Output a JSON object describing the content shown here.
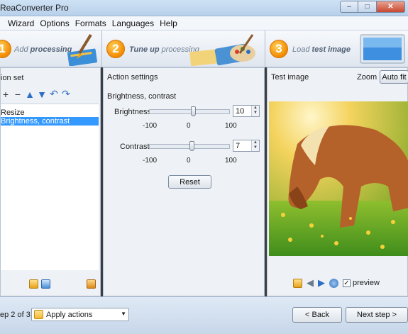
{
  "window": {
    "title": "ReaConverter Pro"
  },
  "menu": [
    "Wizard",
    "Options",
    "Formats",
    "Languages",
    "Help"
  ],
  "steps": [
    {
      "num": "1",
      "pre": "Add",
      "bold": "processing"
    },
    {
      "num": "2",
      "pre": "Tune up",
      "bold": "processing"
    },
    {
      "num": "3",
      "pre": "Load",
      "bold": "test image"
    }
  ],
  "left_panel": {
    "title": "ion set",
    "actions": [
      {
        "label": "Resize",
        "selected": false
      },
      {
        "label": "Brightness, contrast",
        "selected": true
      }
    ]
  },
  "middle_panel": {
    "title": "Action settings",
    "subtitle": "Brightness, contrast",
    "sliders": [
      {
        "label": "Brightness",
        "value": "10",
        "min": "-100",
        "mid": "0",
        "max": "100",
        "position": 0.55
      },
      {
        "label": "Contrast",
        "value": "7",
        "min": "-100",
        "mid": "0",
        "max": "100",
        "position": 0.535
      }
    ],
    "reset_label": "Reset"
  },
  "right_panel": {
    "title": "Test image",
    "zoom_label": "Zoom",
    "zoom_value": "Auto fit",
    "preview_label": "preview",
    "preview_checked": true
  },
  "bottom": {
    "step_text": "ep 2 of 3:",
    "apply_label": "Apply actions",
    "back_label": "< Back",
    "next_label": "Next step >"
  },
  "colors": {
    "selection": "#3399ff",
    "accent_orange": "#f28a00"
  }
}
